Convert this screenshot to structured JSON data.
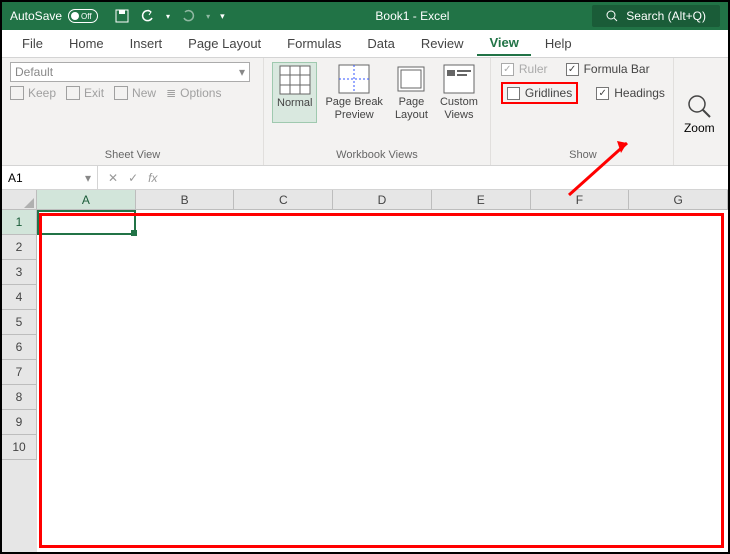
{
  "titlebar": {
    "autosave": "AutoSave",
    "toggle": "Off",
    "doc_title": "Book1  -  Excel",
    "search": "Search (Alt+Q)"
  },
  "tabs": [
    "File",
    "Home",
    "Insert",
    "Page Layout",
    "Formulas",
    "Data",
    "Review",
    "View",
    "Help"
  ],
  "active_tab": "View",
  "ribbon": {
    "sheet_view": {
      "dropdown": "Default",
      "keep": "Keep",
      "exit": "Exit",
      "new": "New",
      "options": "Options",
      "label": "Sheet View"
    },
    "workbook_views": {
      "normal": "Normal",
      "page_break": "Page Break\nPreview",
      "page_layout": "Page\nLayout",
      "custom": "Custom\nViews",
      "label": "Workbook Views"
    },
    "show": {
      "ruler": "Ruler",
      "formula_bar": "Formula Bar",
      "gridlines": "Gridlines",
      "headings": "Headings",
      "label": "Show"
    },
    "zoom": "Zoom"
  },
  "namebox": "A1",
  "fx": "fx",
  "columns": [
    "A",
    "B",
    "C",
    "D",
    "E",
    "F",
    "G"
  ],
  "rows": [
    "1",
    "2",
    "3",
    "4",
    "5",
    "6",
    "7",
    "8",
    "9",
    "10"
  ],
  "selected_col": "A",
  "selected_row": "1"
}
